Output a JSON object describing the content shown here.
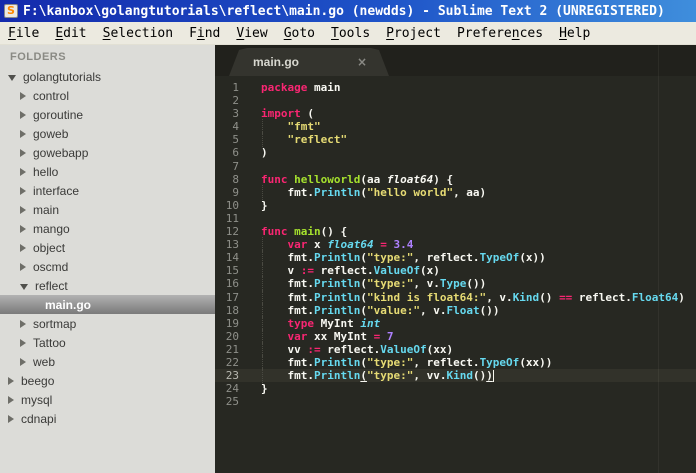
{
  "window": {
    "title": "F:\\kanbox\\golangtutorials\\reflect\\main.go (newdds) - Sublime Text 2 (UNREGISTERED)",
    "icon_glyph": "S"
  },
  "menu": {
    "items": [
      {
        "label": "File",
        "mnemonic": 0
      },
      {
        "label": "Edit",
        "mnemonic": 0
      },
      {
        "label": "Selection",
        "mnemonic": 0
      },
      {
        "label": "Find",
        "mnemonic": 1
      },
      {
        "label": "View",
        "mnemonic": 0
      },
      {
        "label": "Goto",
        "mnemonic": 0
      },
      {
        "label": "Tools",
        "mnemonic": 0
      },
      {
        "label": "Project",
        "mnemonic": 0
      },
      {
        "label": "Preferences",
        "mnemonic": 7
      },
      {
        "label": "Help",
        "mnemonic": 0
      }
    ]
  },
  "sidebar": {
    "header": "FOLDERS",
    "items": [
      {
        "label": "golangtutorials",
        "level": 0,
        "state": "open"
      },
      {
        "label": "control",
        "level": 1,
        "state": "closed"
      },
      {
        "label": "goroutine",
        "level": 1,
        "state": "closed"
      },
      {
        "label": "goweb",
        "level": 1,
        "state": "closed"
      },
      {
        "label": "gowebapp",
        "level": 1,
        "state": "closed"
      },
      {
        "label": "hello",
        "level": 1,
        "state": "closed"
      },
      {
        "label": "interface",
        "level": 1,
        "state": "closed"
      },
      {
        "label": "main",
        "level": 1,
        "state": "closed"
      },
      {
        "label": "mango",
        "level": 1,
        "state": "closed"
      },
      {
        "label": "object",
        "level": 1,
        "state": "closed"
      },
      {
        "label": "oscmd",
        "level": 1,
        "state": "closed"
      },
      {
        "label": "reflect",
        "level": 1,
        "state": "open"
      },
      {
        "label": "main.go",
        "level": 2,
        "state": "file",
        "selected": true
      },
      {
        "label": "sortmap",
        "level": 1,
        "state": "closed"
      },
      {
        "label": "Tattoo",
        "level": 1,
        "state": "closed"
      },
      {
        "label": "web",
        "level": 1,
        "state": "closed"
      },
      {
        "label": "beego",
        "level": 0,
        "state": "closed"
      },
      {
        "label": "mysql",
        "level": 0,
        "state": "closed"
      },
      {
        "label": "cdnapi",
        "level": 0,
        "state": "closed"
      }
    ]
  },
  "tabs": [
    {
      "label": "main.go",
      "close_glyph": "×",
      "active": true
    }
  ],
  "editor": {
    "language": "Go",
    "current_line": 23,
    "lines": [
      {
        "n": 1,
        "tokens": [
          [
            "k",
            "package"
          ],
          [
            "w",
            " main"
          ]
        ]
      },
      {
        "n": 2,
        "tokens": []
      },
      {
        "n": 3,
        "tokens": [
          [
            "k",
            "import"
          ],
          [
            "w",
            " ("
          ]
        ]
      },
      {
        "n": 4,
        "guide": true,
        "tokens": [
          [
            "w",
            "    "
          ],
          [
            "s",
            "\"fmt\""
          ]
        ]
      },
      {
        "n": 5,
        "guide": true,
        "tokens": [
          [
            "w",
            "    "
          ],
          [
            "s",
            "\"reflect\""
          ]
        ]
      },
      {
        "n": 6,
        "tokens": [
          [
            "w",
            ")"
          ]
        ]
      },
      {
        "n": 7,
        "tokens": []
      },
      {
        "n": 8,
        "tokens": [
          [
            "k",
            "func"
          ],
          [
            "w",
            " "
          ],
          [
            "f",
            "helloworld"
          ],
          [
            "w",
            "(aa "
          ],
          [
            "ti",
            "float64"
          ],
          [
            "w",
            ") {"
          ]
        ]
      },
      {
        "n": 9,
        "guide": true,
        "tokens": [
          [
            "w",
            "    fmt."
          ],
          [
            "u",
            "Println"
          ],
          [
            "w",
            "("
          ],
          [
            "s",
            "\"hello world\""
          ],
          [
            "w",
            ", aa)"
          ]
        ]
      },
      {
        "n": 10,
        "tokens": [
          [
            "w",
            "}"
          ]
        ]
      },
      {
        "n": 11,
        "tokens": []
      },
      {
        "n": 12,
        "tokens": [
          [
            "k",
            "func"
          ],
          [
            "w",
            " "
          ],
          [
            "f",
            "main"
          ],
          [
            "w",
            "() {"
          ]
        ]
      },
      {
        "n": 13,
        "guide": true,
        "tokens": [
          [
            "w",
            "    "
          ],
          [
            "k",
            "var"
          ],
          [
            "w",
            " x "
          ],
          [
            "t",
            "float64"
          ],
          [
            "w",
            " "
          ],
          [
            "k",
            "="
          ],
          [
            "w",
            " "
          ],
          [
            "n_",
            "3.4"
          ]
        ]
      },
      {
        "n": 14,
        "guide": true,
        "tokens": [
          [
            "w",
            "    fmt."
          ],
          [
            "u",
            "Println"
          ],
          [
            "w",
            "("
          ],
          [
            "s",
            "\"type:\""
          ],
          [
            "w",
            ", reflect."
          ],
          [
            "u",
            "TypeOf"
          ],
          [
            "w",
            "(x))"
          ]
        ]
      },
      {
        "n": 15,
        "guide": true,
        "tokens": [
          [
            "w",
            "    v "
          ],
          [
            "k",
            ":="
          ],
          [
            "w",
            " reflect."
          ],
          [
            "u",
            "ValueOf"
          ],
          [
            "w",
            "(x)"
          ]
        ]
      },
      {
        "n": 16,
        "guide": true,
        "tokens": [
          [
            "w",
            "    fmt."
          ],
          [
            "u",
            "Println"
          ],
          [
            "w",
            "("
          ],
          [
            "s",
            "\"type:\""
          ],
          [
            "w",
            ", v."
          ],
          [
            "u",
            "Type"
          ],
          [
            "w",
            "())"
          ]
        ]
      },
      {
        "n": 17,
        "guide": true,
        "tokens": [
          [
            "w",
            "    fmt."
          ],
          [
            "u",
            "Println"
          ],
          [
            "w",
            "("
          ],
          [
            "s",
            "\"kind is float64:\""
          ],
          [
            "w",
            ", v."
          ],
          [
            "u",
            "Kind"
          ],
          [
            "w",
            "() "
          ],
          [
            "k",
            "=="
          ],
          [
            "w",
            " reflect."
          ],
          [
            "u",
            "Float64"
          ],
          [
            "w",
            ")"
          ]
        ]
      },
      {
        "n": 18,
        "guide": true,
        "tokens": [
          [
            "w",
            "    fmt."
          ],
          [
            "u",
            "Println"
          ],
          [
            "w",
            "("
          ],
          [
            "s",
            "\"value:\""
          ],
          [
            "w",
            ", v."
          ],
          [
            "u",
            "Float"
          ],
          [
            "w",
            "())"
          ]
        ]
      },
      {
        "n": 19,
        "guide": true,
        "tokens": [
          [
            "w",
            "    "
          ],
          [
            "k",
            "type"
          ],
          [
            "w",
            " MyInt "
          ],
          [
            "t",
            "int"
          ]
        ]
      },
      {
        "n": 20,
        "guide": true,
        "tokens": [
          [
            "w",
            "    "
          ],
          [
            "k",
            "var"
          ],
          [
            "w",
            " xx MyInt "
          ],
          [
            "k",
            "="
          ],
          [
            "w",
            " "
          ],
          [
            "n_",
            "7"
          ]
        ]
      },
      {
        "n": 21,
        "guide": true,
        "tokens": [
          [
            "w",
            "    vv "
          ],
          [
            "k",
            ":="
          ],
          [
            "w",
            " reflect."
          ],
          [
            "u",
            "ValueOf"
          ],
          [
            "w",
            "(xx)"
          ]
        ]
      },
      {
        "n": 22,
        "guide": true,
        "tokens": [
          [
            "w",
            "    fmt."
          ],
          [
            "u",
            "Println"
          ],
          [
            "w",
            "("
          ],
          [
            "s",
            "\"type:\""
          ],
          [
            "w",
            ", reflect."
          ],
          [
            "u",
            "TypeOf"
          ],
          [
            "w",
            "(xx))"
          ]
        ]
      },
      {
        "n": 23,
        "guide": true,
        "tokens": [
          [
            "w",
            "    fmt."
          ],
          [
            "u",
            "Println"
          ],
          [
            "b",
            "("
          ],
          [
            "s",
            "\"type:\""
          ],
          [
            "w",
            ", vv."
          ],
          [
            "u",
            "Kind"
          ],
          [
            "w",
            "()"
          ],
          [
            "b",
            ")"
          ],
          [
            "c",
            ""
          ]
        ]
      },
      {
        "n": 24,
        "tokens": [
          [
            "w",
            "}"
          ]
        ]
      },
      {
        "n": 25,
        "tokens": []
      }
    ]
  },
  "colors": {
    "titlebar_left": "#142aac",
    "titlebar_right": "#3f8edc",
    "menubar_bg": "#eceae0",
    "sidebar_bg": "#dcdcd8",
    "sidebar_selected_top": "#b2b2b2",
    "sidebar_selected_bottom": "#7a7a7a",
    "editor_bg": "#272822",
    "tabstrip_bg": "#21211c",
    "tab_bg": "#34342e",
    "keyword": "#f92672",
    "string": "#e6db74",
    "function_def": "#a6e22e",
    "support_function": "#66d9ef",
    "number": "#ae81ff",
    "foreground": "#f8f8f2",
    "line_number": "#8f908a"
  }
}
